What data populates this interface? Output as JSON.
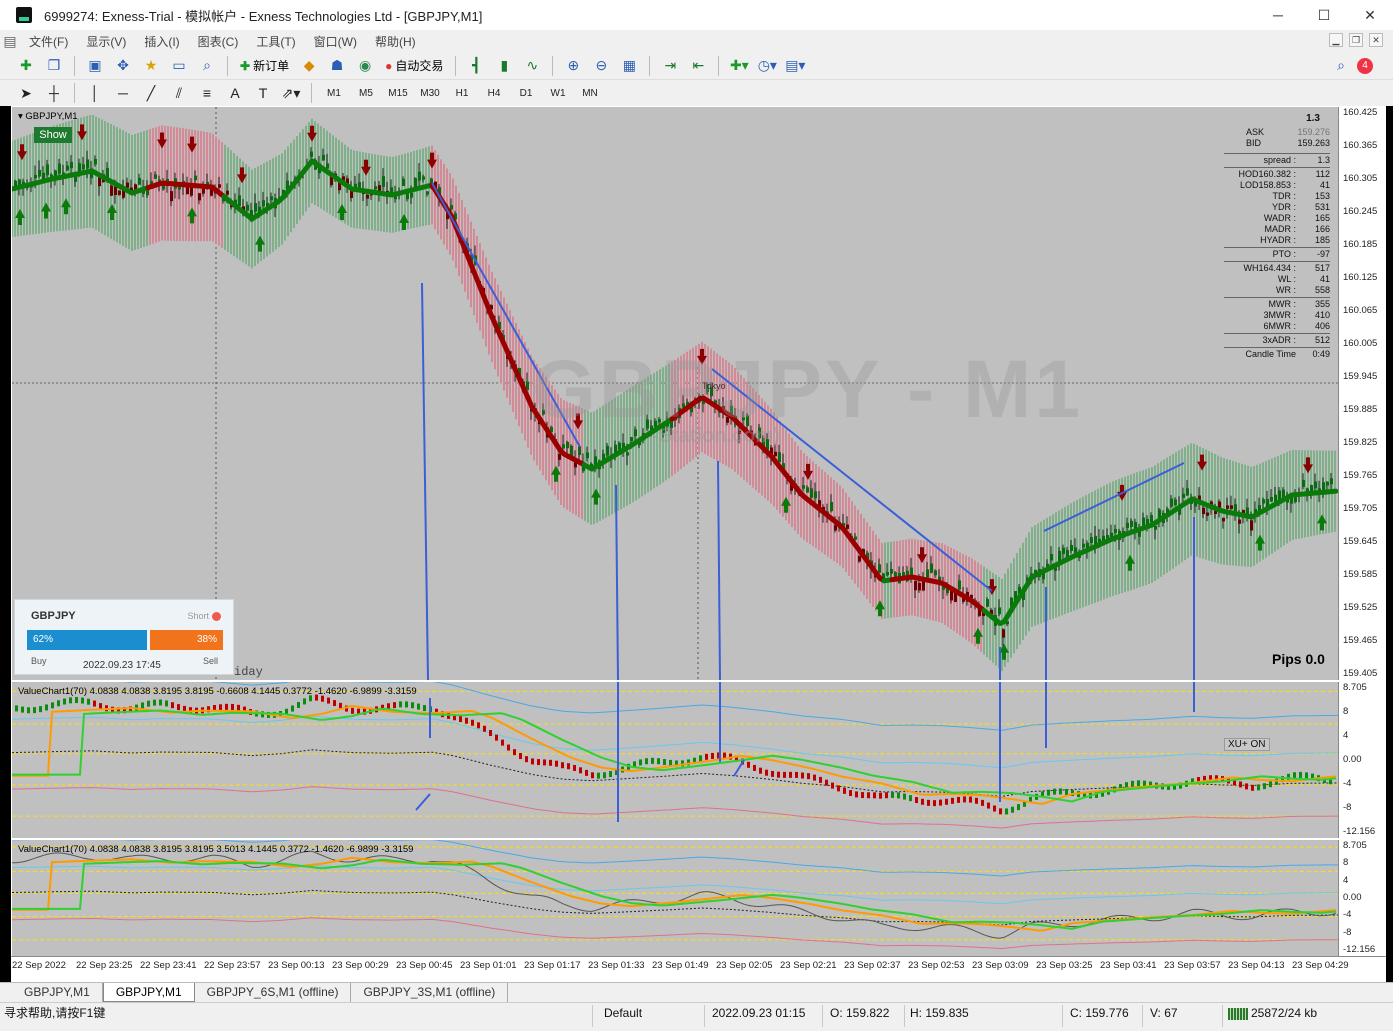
{
  "window": {
    "title": "6999274: Exness-Trial - 模拟帐户 - Exness Technologies Ltd - [GBPJPY,M1]",
    "minimize": "─",
    "maximize": "☐",
    "close": "✕"
  },
  "menu": [
    "文件(F)",
    "显示(V)",
    "插入(I)",
    "图表(C)",
    "工具(T)",
    "窗口(W)",
    "帮助(H)"
  ],
  "toolbar": {
    "new_order": "新订单",
    "auto_trading": "自动交易",
    "notification_count": "4",
    "timeframes": [
      "M1",
      "M5",
      "M15",
      "M30",
      "H1",
      "H4",
      "D1",
      "W1",
      "MN"
    ],
    "active_timeframe": "M1"
  },
  "chart": {
    "symbol_title": "GBPJPY,M1",
    "show_button": "Show",
    "watermark": "GBPJPY - M1",
    "watermark_sub": "-Station.com)",
    "session_label": "Tokyo",
    "session_label_2": "iday",
    "pips": "Pips 0.0",
    "price_axis": [
      "160.425",
      "160.365",
      "160.305",
      "160.245",
      "160.185",
      "160.125",
      "160.065",
      "160.005",
      "159.945",
      "159.885",
      "159.825",
      "159.765",
      "159.705",
      "159.645",
      "159.585",
      "159.525",
      "159.465",
      "159.405"
    ],
    "info_panel": {
      "spread_top": "1.3",
      "ask_label": "ASK",
      "ask": "159.276",
      "bid_label": "BID",
      "bid": "159.263",
      "rows": [
        {
          "k": "spread :",
          "v": "1.3",
          "sep": true
        },
        {
          "k": "HOD160.382 :",
          "v": "112",
          "sep": true
        },
        {
          "k": "LOD158.853 :",
          "v": "41"
        },
        {
          "k": "TDR :",
          "v": "153"
        },
        {
          "k": "YDR :",
          "v": "531"
        },
        {
          "k": "WADR :",
          "v": "165"
        },
        {
          "k": "MADR :",
          "v": "166"
        },
        {
          "k": "HYADR :",
          "v": "185"
        },
        {
          "k": "PTO :",
          "v": "-97",
          "sep": true
        },
        {
          "k": "WH164.434 :",
          "v": "517",
          "sep": true
        },
        {
          "k": "WL :",
          "v": "41"
        },
        {
          "k": "WR :",
          "v": "558"
        },
        {
          "k": "MWR :",
          "v": "355",
          "sep": true
        },
        {
          "k": "3MWR :",
          "v": "410"
        },
        {
          "k": "6MWR :",
          "v": "406"
        },
        {
          "k": "3xADR :",
          "v": "512",
          "sep": true
        },
        {
          "k": "Candle Time",
          "v": "0:49",
          "sep": true
        }
      ]
    },
    "sentiment": {
      "symbol": "GBPJPY",
      "short_label": "Short",
      "buy_pct": "62%",
      "sell_pct": "38%",
      "buy_label": "Buy",
      "sell_label": "Sell",
      "date": "2022.09.23 17:45",
      "buy_fraction": 0.62
    }
  },
  "value_chart_1": {
    "title": "ValueChart1(70) 4.0838 4.0838 3.8195 3.8195 -0.6608 4.1445 0.3772 -1.4620 -6.9899 -3.3159",
    "axis": [
      "8.705",
      "8",
      "4",
      "0.00",
      "-4",
      "-8",
      "-12.156"
    ],
    "xu_label": "XU+ ON"
  },
  "value_chart_2": {
    "title": "ValueChart1(70) 4.0838 4.0838 3.8195 3.8195 3.5013 4.1445 0.3772 -1.4620 -6.9899 -3.3159",
    "axis": [
      "8.705",
      "8",
      "4",
      "0.00",
      "-4",
      "-8",
      "-12.156"
    ]
  },
  "time_axis": [
    "22 Sep 2022",
    "22 Sep 23:25",
    "22 Sep 23:41",
    "22 Sep 23:57",
    "23 Sep 00:13",
    "23 Sep 00:29",
    "23 Sep 00:45",
    "23 Sep 01:01",
    "23 Sep 01:17",
    "23 Sep 01:33",
    "23 Sep 01:49",
    "23 Sep 02:05",
    "23 Sep 02:21",
    "23 Sep 02:37",
    "23 Sep 02:53",
    "23 Sep 03:09",
    "23 Sep 03:25",
    "23 Sep 03:41",
    "23 Sep 03:57",
    "23 Sep 04:13",
    "23 Sep 04:29"
  ],
  "tabs": [
    "GBPJPY,M1",
    "GBPJPY,M1",
    "GBPJPY_6S,M1 (offline)",
    "GBPJPY_3S,M1 (offline)"
  ],
  "active_tab": 1,
  "status": {
    "help": "寻求帮助,请按F1键",
    "profile": "Default",
    "datetime": "2022.09.23 01:15",
    "open": "O: 159.822",
    "high": "H: 159.835",
    "close": "C: 159.776",
    "volume": "V: 67",
    "traffic": "25872/24 kb"
  },
  "colors": {
    "chart_bg": "#c0c0c0",
    "bull": "#0a7a12",
    "bear": "#8b0000",
    "band_green": "#7fb08a",
    "band_red": "#d28a96",
    "arrow_blue": "#3a5fd8",
    "orange": "#ff9a00",
    "lime": "#2fd02f"
  }
}
